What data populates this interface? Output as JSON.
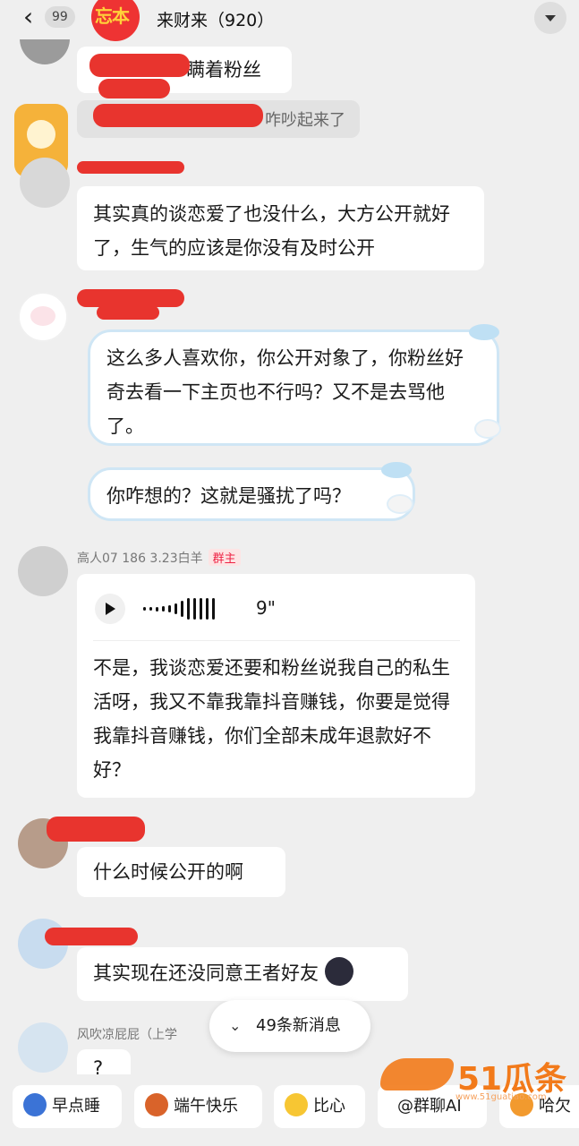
{
  "header": {
    "back_badge": "99",
    "group_avatar_text": "忘本",
    "title": "来财来（920）"
  },
  "messages": {
    "m1": {
      "text": "瞒着粉丝"
    },
    "m2": {
      "text": "咋吵起来了"
    },
    "m3": {
      "text": "其实真的谈恋爱了也没什么，大方公开就好了，生气的应该是你没有及时公开"
    },
    "m4a": {
      "text": "这么多人喜欢你，你公开对象了，你粉丝好奇去看一下主页也不行吗？又不是去骂他了。"
    },
    "m4b": {
      "text": "你咋想的？这就是骚扰了吗？"
    },
    "m5": {
      "nickname": "高人07 186 3.23白羊",
      "role_tag": "群主",
      "voice_duration": "9\"",
      "text": "不是，我谈恋爱还要和粉丝说我自己的私生活呀，我又不靠我靠抖音赚钱，你要是觉得我靠抖音赚钱，你们全部未成年退款好不好？"
    },
    "m6": {
      "text": "什么时候公开的啊"
    },
    "m7": {
      "text": "其实现在还没同意王者好友"
    },
    "m8": {
      "nickname": "风吹凉屁屁（上学",
      "text": "?"
    }
  },
  "new_messages": {
    "label": "49条新消息"
  },
  "quick_replies": [
    {
      "label": "早点睡"
    },
    {
      "label": "端午快乐"
    },
    {
      "label": "比心"
    },
    {
      "label": "@群聊AI"
    },
    {
      "label": "哈欠"
    }
  ],
  "watermark": {
    "text": "51瓜条",
    "url": "www.51guatiao.com"
  },
  "colors": {
    "redact": "#e8342e",
    "owner_tag": "#e22244",
    "watermark": "#f27a1a"
  }
}
